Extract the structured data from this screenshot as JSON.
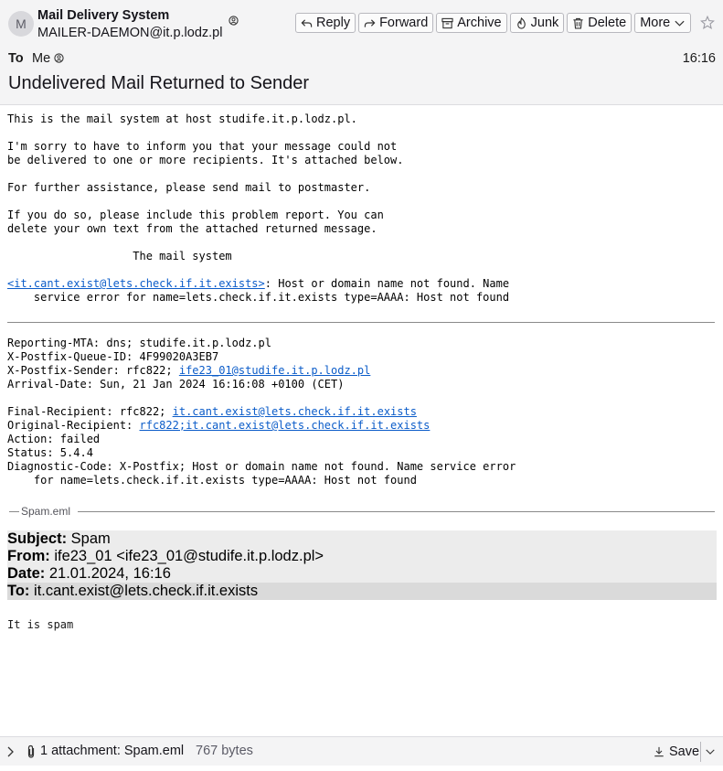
{
  "header": {
    "avatar_letter": "M",
    "from_name": "Mail Delivery System",
    "from_address": "MAILER-DAEMON@it.p.lodz.pl",
    "to_label": "To",
    "to_value": "Me",
    "time": "16:16",
    "subject": "Undelivered Mail Returned to Sender"
  },
  "toolbar": {
    "reply": "Reply",
    "forward": "Forward",
    "archive": "Archive",
    "junk": "Junk",
    "delete": "Delete",
    "more": "More"
  },
  "message": {
    "intro": "This is the mail system at host studife.it.p.lodz.pl.\n\nI'm sorry to have to inform you that your message could not\nbe delivered to one or more recipients. It's attached below.\n\nFor further assistance, please send mail to postmaster.\n\nIf you do so, please include this problem report. You can\ndelete your own text from the attached returned message.\n\n                   The mail system\n\n",
    "recipient_link": "<it.cant.exist@lets.check.if.it.exists>",
    "recipient_error": ": Host or domain name not found. Name\n    service error for name=lets.check.if.it.exists type=AAAA: Host not found",
    "meta_1": "Reporting-MTA: dns; studife.it.p.lodz.pl\nX-Postfix-Queue-ID: 4F99020A3EB7\nX-Postfix-Sender: rfc822; ",
    "sender_link": "ife23_01@studife.it.p.lodz.pl",
    "meta_2": "\nArrival-Date: Sun, 21 Jan 2024 16:16:08 +0100 (CET)\n\nFinal-Recipient: rfc822; ",
    "final_recipient_link": "it.cant.exist@lets.check.if.it.exists",
    "meta_3": "\nOriginal-Recipient: ",
    "original_recipient_link": "rfc822;it.cant.exist@lets.check.if.it.exists",
    "meta_4": "\nAction: failed\nStatus: 5.4.4\nDiagnostic-Code: X-Postfix; Host or domain name not found. Name service error\n    for name=lets.check.if.it.exists type=AAAA: Host not found"
  },
  "attached_message": {
    "legend": "Spam.eml",
    "subject_label": "Subject:",
    "subject_value": " Spam",
    "from_label": "From:",
    "from_value": " ife23_01 <ife23_01@studife.it.p.lodz.pl>",
    "date_label": "Date:",
    "date_value": " 21.01.2024, 16:16",
    "to_label": "To:",
    "to_value": " it.cant.exist@lets.check.if.it.exists",
    "body": "It is spam"
  },
  "attachment_bar": {
    "summary": "1 attachment: Spam.eml",
    "size": "767 bytes",
    "save_label": "Save"
  },
  "colors": {
    "link": "#0b5cc9",
    "header_bg": "#f4f4f5"
  }
}
